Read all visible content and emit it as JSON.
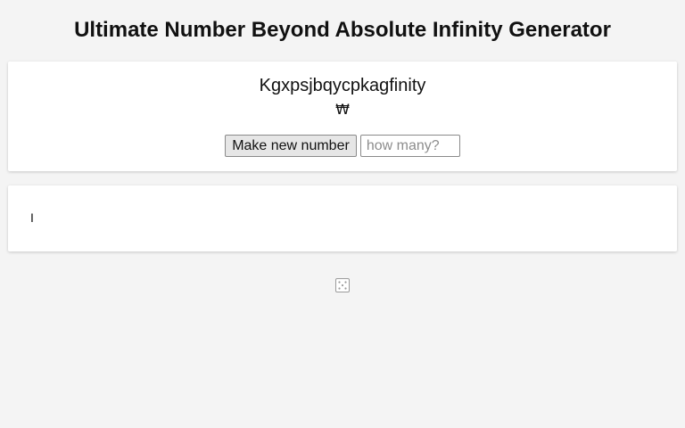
{
  "header": {
    "title": "Ultimate Number Beyond Absolute Infinity Generator"
  },
  "generator": {
    "number_name": "Kgxpsjbqycpkagfinity",
    "number_symbol": "₩",
    "make_button_label": "Make new number",
    "count_placeholder": "how many?",
    "count_value": ""
  },
  "output": {
    "text": "I"
  },
  "footer": {
    "icon": "dice-icon"
  }
}
